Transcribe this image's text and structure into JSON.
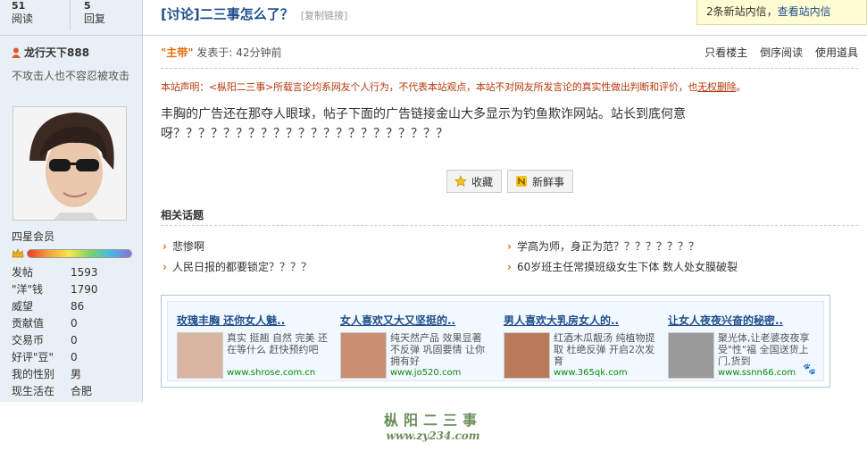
{
  "stats": [
    {
      "num": "51",
      "label": "阅读"
    },
    {
      "num": "5",
      "label": "回复"
    }
  ],
  "thread": {
    "title": "[讨论]二三事怎么了？",
    "copy_link": "[复制链接]"
  },
  "notice": {
    "text": "2条新站内信，",
    "link": "查看站内信"
  },
  "user": {
    "name": "龙行天下888",
    "signature": "不攻击人也不容忍被攻击",
    "rank": "四星会员",
    "info": [
      {
        "k": "发帖",
        "v": "1593"
      },
      {
        "k": "\"洋\"钱",
        "v": "1790"
      },
      {
        "k": "威望",
        "v": "86"
      },
      {
        "k": "贡献值",
        "v": "0"
      },
      {
        "k": "交易币",
        "v": "0"
      },
      {
        "k": "好评\"豆\"",
        "v": "0"
      },
      {
        "k": "我的性别",
        "v": "男"
      },
      {
        "k": "现生活在",
        "v": "合肥"
      }
    ]
  },
  "post": {
    "role": "\"主带\"",
    "posted": "发表于: 42分钟前",
    "actions": [
      "只看楼主",
      "倒序阅读",
      "使用道具"
    ],
    "disclaimer_a": "本站声明：<枞阳二三事>所载言论均系网友个人行为，不代表本站观点，本站不对网友所发言论的真实性做出判断和评价，也",
    "disclaimer_b": "无权删除",
    "disclaimer_c": "。",
    "body": "丰胸的广告还在那夺人眼球，帖子下面的广告链接金山大多显示为钓鱼欺诈网站。站长到底何意呀？？？？？？？？？？？？？？？？？？？？？？",
    "btn_fav": "收藏",
    "btn_new": "新鲜事"
  },
  "related": {
    "title": "相关话题",
    "items": [
      "悲惨啊",
      "学高为师，身正为范？？？？？？？？",
      "人民日报的都要锁定？？？？",
      "60岁班主任常摸班级女生下体 数人处女膜破裂"
    ]
  },
  "ads": [
    {
      "title": "玫瑰丰胸 还你女人魅..",
      "desc": "真实 挺翘 自然 完美 还在等什么 赶快预约吧",
      "url": "www.shrose.com.cn"
    },
    {
      "title": "女人喜欢又大又坚挺的..",
      "desc": "纯天然产品 效果显著 不反弹 巩固要情 让你拥有好",
      "url": "www.jo520.com"
    },
    {
      "title": "男人喜欢大乳房女人的..",
      "desc": "红酒木瓜靓汤 纯植物提取 杜绝反弹 开启2次发育",
      "url": "www.365qk.com"
    },
    {
      "title": "让女人夜夜兴奋的秘密..",
      "desc": "聚光体,让老婆夜夜享受\"性\"福 全国送货上门,货到",
      "url": "www.ssnn66.com"
    }
  ],
  "watermark": {
    "line1": "枞阳二三事",
    "line2": "www.zy234.com"
  }
}
